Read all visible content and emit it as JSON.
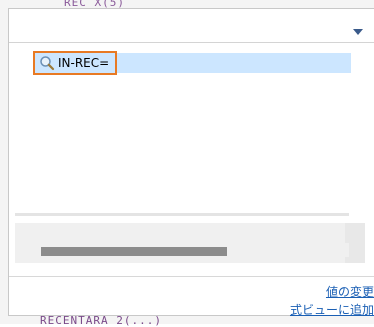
{
  "background": {
    "top_text": "REC  X(5)",
    "bottom_text": "RECENTARA  2(...)"
  },
  "tree": {
    "items": [
      {
        "label": "IN-REC=",
        "icon": "search-icon"
      }
    ]
  },
  "footer": {
    "change_value_label": "値の変更",
    "add_watch_label": "式ビューに追加"
  },
  "colors": {
    "selection": "#cce6ff",
    "focus_border": "#e87a24",
    "link": "#1a5fb4",
    "dropdown_arrow": "#3a5a8a"
  }
}
